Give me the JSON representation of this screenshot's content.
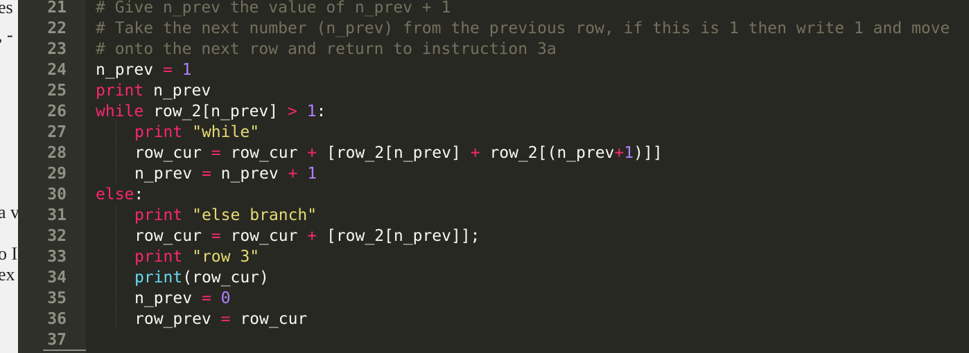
{
  "background_text": {
    "fragments": [
      "es",
      ", -",
      "a v",
      "o I",
      "ex"
    ]
  },
  "editor": {
    "language": "python",
    "colors": {
      "background": "#272822",
      "comment": "#75715e",
      "keyword": "#f92672",
      "number": "#ae81ff",
      "string": "#e6db74",
      "builtin": "#66d9ef",
      "text": "#f8f8f2"
    },
    "lines": [
      {
        "number": "21",
        "indent": 0,
        "tokens": [
          {
            "t": "c",
            "v": "# Give n_prev the value of n_prev + 1"
          }
        ]
      },
      {
        "number": "22",
        "indent": 0,
        "tokens": [
          {
            "t": "c",
            "v": "# Take the next number (n_prev) from the previous row, if this is 1 then write 1 and move"
          }
        ]
      },
      {
        "number": "23",
        "indent": 0,
        "tokens": [
          {
            "t": "c",
            "v": "# onto the next row and return to instruction 3a"
          }
        ]
      },
      {
        "number": "24",
        "indent": 0,
        "tokens": [
          {
            "t": "p",
            "v": "n_prev "
          },
          {
            "t": "o",
            "v": "="
          },
          {
            "t": "p",
            "v": " "
          },
          {
            "t": "n",
            "v": "1"
          }
        ]
      },
      {
        "number": "25",
        "indent": 0,
        "tokens": [
          {
            "t": "k",
            "v": "print"
          },
          {
            "t": "p",
            "v": " n_prev"
          }
        ]
      },
      {
        "number": "26",
        "indent": 0,
        "tokens": [
          {
            "t": "k",
            "v": "while"
          },
          {
            "t": "p",
            "v": " row_2[n_prev] "
          },
          {
            "t": "o",
            "v": ">"
          },
          {
            "t": "p",
            "v": " "
          },
          {
            "t": "n",
            "v": "1"
          },
          {
            "t": "p",
            "v": ":"
          }
        ]
      },
      {
        "number": "27",
        "indent": 1,
        "tokens": [
          {
            "t": "k",
            "v": "print"
          },
          {
            "t": "p",
            "v": " "
          },
          {
            "t": "s",
            "v": "\"while\""
          }
        ]
      },
      {
        "number": "28",
        "indent": 1,
        "tokens": [
          {
            "t": "p",
            "v": "row_cur "
          },
          {
            "t": "o",
            "v": "="
          },
          {
            "t": "p",
            "v": " row_cur "
          },
          {
            "t": "o",
            "v": "+"
          },
          {
            "t": "p",
            "v": " [row_2[n_prev] "
          },
          {
            "t": "o",
            "v": "+"
          },
          {
            "t": "p",
            "v": " row_2[(n_prev"
          },
          {
            "t": "o",
            "v": "+"
          },
          {
            "t": "n",
            "v": "1"
          },
          {
            "t": "p",
            "v": ")]]"
          }
        ]
      },
      {
        "number": "29",
        "indent": 1,
        "tokens": [
          {
            "t": "p",
            "v": "n_prev "
          },
          {
            "t": "o",
            "v": "="
          },
          {
            "t": "p",
            "v": " n_prev "
          },
          {
            "t": "o",
            "v": "+"
          },
          {
            "t": "p",
            "v": " "
          },
          {
            "t": "n",
            "v": "1"
          }
        ]
      },
      {
        "number": "30",
        "indent": 0,
        "tokens": [
          {
            "t": "k",
            "v": "else"
          },
          {
            "t": "p",
            "v": ":"
          }
        ]
      },
      {
        "number": "31",
        "indent": 1,
        "tokens": [
          {
            "t": "k",
            "v": "print"
          },
          {
            "t": "p",
            "v": " "
          },
          {
            "t": "s",
            "v": "\"else branch\""
          }
        ]
      },
      {
        "number": "32",
        "indent": 1,
        "tokens": [
          {
            "t": "p",
            "v": "row_cur "
          },
          {
            "t": "o",
            "v": "="
          },
          {
            "t": "p",
            "v": " row_cur "
          },
          {
            "t": "o",
            "v": "+"
          },
          {
            "t": "p",
            "v": " [row_2[n_prev]];"
          }
        ]
      },
      {
        "number": "33",
        "indent": 1,
        "tokens": [
          {
            "t": "k",
            "v": "print"
          },
          {
            "t": "p",
            "v": " "
          },
          {
            "t": "s",
            "v": "\"row 3\""
          }
        ]
      },
      {
        "number": "34",
        "indent": 1,
        "tokens": [
          {
            "t": "f",
            "v": "print"
          },
          {
            "t": "p",
            "v": "(row_cur)"
          }
        ]
      },
      {
        "number": "35",
        "indent": 1,
        "tokens": [
          {
            "t": "p",
            "v": "n_prev "
          },
          {
            "t": "o",
            "v": "="
          },
          {
            "t": "p",
            "v": " "
          },
          {
            "t": "n",
            "v": "0"
          }
        ]
      },
      {
        "number": "36",
        "indent": 1,
        "tokens": [
          {
            "t": "p",
            "v": "row_prev "
          },
          {
            "t": "o",
            "v": "="
          },
          {
            "t": "p",
            "v": " row_cur"
          }
        ]
      },
      {
        "number": "37",
        "indent": 0,
        "tokens": []
      }
    ]
  }
}
